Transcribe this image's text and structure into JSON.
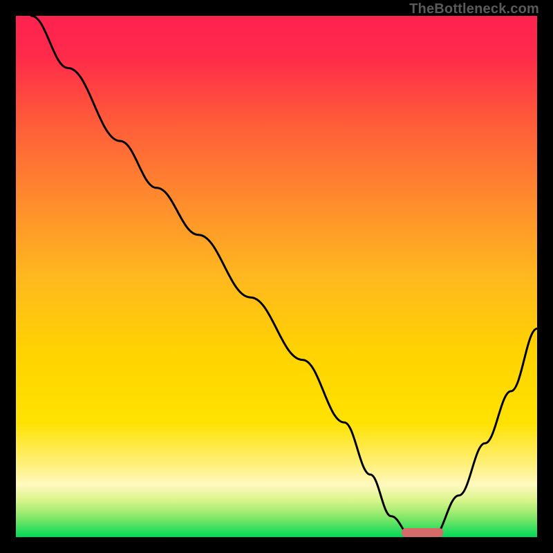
{
  "watermark": "TheBottleneck.com",
  "chart_data": {
    "type": "line",
    "title": "",
    "xlabel": "",
    "ylabel": "",
    "xlim": [
      0,
      100
    ],
    "ylim": [
      0,
      100
    ],
    "curve": {
      "name": "bottleneck-curve",
      "x": [
        3,
        10,
        20,
        27,
        35,
        45,
        55,
        63,
        68,
        72,
        76,
        80,
        85,
        90,
        95,
        100
      ],
      "y": [
        100,
        90,
        76,
        67,
        58,
        46,
        34,
        22,
        12,
        4,
        0,
        0,
        8,
        18,
        28,
        40
      ]
    },
    "marker": {
      "name": "optimal-range",
      "x_start": 74,
      "x_end": 82,
      "y": 0,
      "color": "#d46a6a"
    },
    "background_gradient": {
      "top_color": "#ff1a4a",
      "mid_color": "#ffd400",
      "bottom_band_color": "#00e05a"
    }
  }
}
